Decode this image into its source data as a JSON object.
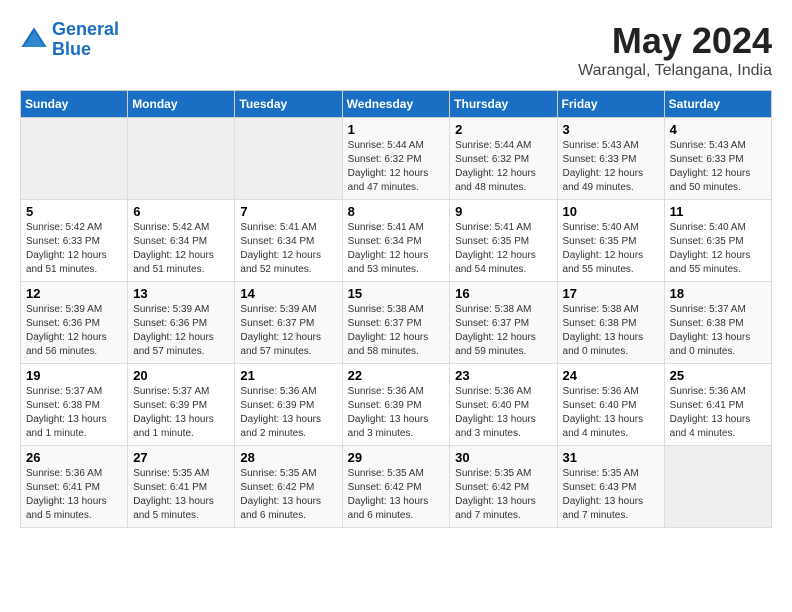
{
  "logo": {
    "line1": "General",
    "line2": "Blue"
  },
  "title": "May 2024",
  "location": "Warangal, Telangana, India",
  "weekdays": [
    "Sunday",
    "Monday",
    "Tuesday",
    "Wednesday",
    "Thursday",
    "Friday",
    "Saturday"
  ],
  "weeks": [
    [
      {
        "day": "",
        "info": ""
      },
      {
        "day": "",
        "info": ""
      },
      {
        "day": "",
        "info": ""
      },
      {
        "day": "1",
        "info": "Sunrise: 5:44 AM\nSunset: 6:32 PM\nDaylight: 12 hours\nand 47 minutes."
      },
      {
        "day": "2",
        "info": "Sunrise: 5:44 AM\nSunset: 6:32 PM\nDaylight: 12 hours\nand 48 minutes."
      },
      {
        "day": "3",
        "info": "Sunrise: 5:43 AM\nSunset: 6:33 PM\nDaylight: 12 hours\nand 49 minutes."
      },
      {
        "day": "4",
        "info": "Sunrise: 5:43 AM\nSunset: 6:33 PM\nDaylight: 12 hours\nand 50 minutes."
      }
    ],
    [
      {
        "day": "5",
        "info": "Sunrise: 5:42 AM\nSunset: 6:33 PM\nDaylight: 12 hours\nand 51 minutes."
      },
      {
        "day": "6",
        "info": "Sunrise: 5:42 AM\nSunset: 6:34 PM\nDaylight: 12 hours\nand 51 minutes."
      },
      {
        "day": "7",
        "info": "Sunrise: 5:41 AM\nSunset: 6:34 PM\nDaylight: 12 hours\nand 52 minutes."
      },
      {
        "day": "8",
        "info": "Sunrise: 5:41 AM\nSunset: 6:34 PM\nDaylight: 12 hours\nand 53 minutes."
      },
      {
        "day": "9",
        "info": "Sunrise: 5:41 AM\nSunset: 6:35 PM\nDaylight: 12 hours\nand 54 minutes."
      },
      {
        "day": "10",
        "info": "Sunrise: 5:40 AM\nSunset: 6:35 PM\nDaylight: 12 hours\nand 55 minutes."
      },
      {
        "day": "11",
        "info": "Sunrise: 5:40 AM\nSunset: 6:35 PM\nDaylight: 12 hours\nand 55 minutes."
      }
    ],
    [
      {
        "day": "12",
        "info": "Sunrise: 5:39 AM\nSunset: 6:36 PM\nDaylight: 12 hours\nand 56 minutes."
      },
      {
        "day": "13",
        "info": "Sunrise: 5:39 AM\nSunset: 6:36 PM\nDaylight: 12 hours\nand 57 minutes."
      },
      {
        "day": "14",
        "info": "Sunrise: 5:39 AM\nSunset: 6:37 PM\nDaylight: 12 hours\nand 57 minutes."
      },
      {
        "day": "15",
        "info": "Sunrise: 5:38 AM\nSunset: 6:37 PM\nDaylight: 12 hours\nand 58 minutes."
      },
      {
        "day": "16",
        "info": "Sunrise: 5:38 AM\nSunset: 6:37 PM\nDaylight: 12 hours\nand 59 minutes."
      },
      {
        "day": "17",
        "info": "Sunrise: 5:38 AM\nSunset: 6:38 PM\nDaylight: 13 hours\nand 0 minutes."
      },
      {
        "day": "18",
        "info": "Sunrise: 5:37 AM\nSunset: 6:38 PM\nDaylight: 13 hours\nand 0 minutes."
      }
    ],
    [
      {
        "day": "19",
        "info": "Sunrise: 5:37 AM\nSunset: 6:38 PM\nDaylight: 13 hours\nand 1 minute."
      },
      {
        "day": "20",
        "info": "Sunrise: 5:37 AM\nSunset: 6:39 PM\nDaylight: 13 hours\nand 1 minute."
      },
      {
        "day": "21",
        "info": "Sunrise: 5:36 AM\nSunset: 6:39 PM\nDaylight: 13 hours\nand 2 minutes."
      },
      {
        "day": "22",
        "info": "Sunrise: 5:36 AM\nSunset: 6:39 PM\nDaylight: 13 hours\nand 3 minutes."
      },
      {
        "day": "23",
        "info": "Sunrise: 5:36 AM\nSunset: 6:40 PM\nDaylight: 13 hours\nand 3 minutes."
      },
      {
        "day": "24",
        "info": "Sunrise: 5:36 AM\nSunset: 6:40 PM\nDaylight: 13 hours\nand 4 minutes."
      },
      {
        "day": "25",
        "info": "Sunrise: 5:36 AM\nSunset: 6:41 PM\nDaylight: 13 hours\nand 4 minutes."
      }
    ],
    [
      {
        "day": "26",
        "info": "Sunrise: 5:36 AM\nSunset: 6:41 PM\nDaylight: 13 hours\nand 5 minutes."
      },
      {
        "day": "27",
        "info": "Sunrise: 5:35 AM\nSunset: 6:41 PM\nDaylight: 13 hours\nand 5 minutes."
      },
      {
        "day": "28",
        "info": "Sunrise: 5:35 AM\nSunset: 6:42 PM\nDaylight: 13 hours\nand 6 minutes."
      },
      {
        "day": "29",
        "info": "Sunrise: 5:35 AM\nSunset: 6:42 PM\nDaylight: 13 hours\nand 6 minutes."
      },
      {
        "day": "30",
        "info": "Sunrise: 5:35 AM\nSunset: 6:42 PM\nDaylight: 13 hours\nand 7 minutes."
      },
      {
        "day": "31",
        "info": "Sunrise: 5:35 AM\nSunset: 6:43 PM\nDaylight: 13 hours\nand 7 minutes."
      },
      {
        "day": "",
        "info": ""
      }
    ]
  ]
}
